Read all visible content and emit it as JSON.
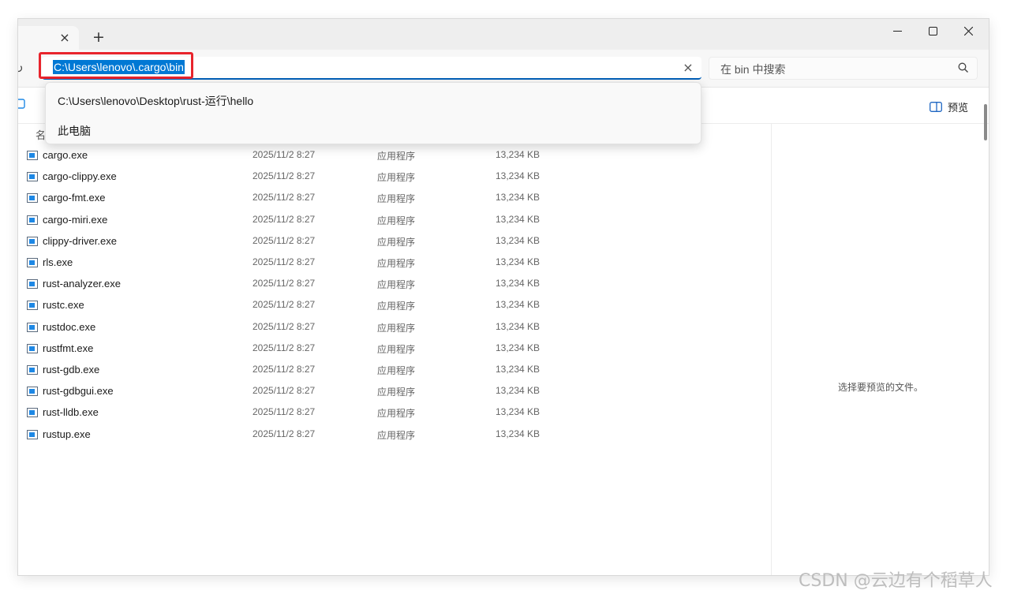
{
  "window": {
    "tab_close": "×",
    "new_tab": "+"
  },
  "toolbar": {
    "refresh_glyph": "↻",
    "address_value": "C:\\Users\\lenovo\\.cargo\\bin",
    "clear_glyph": "×",
    "search_placeholder": "在 bin 中搜索"
  },
  "commandbar": {
    "preview_label": "预览"
  },
  "address_suggestions": [
    "C:\\Users\\lenovo\\Desktop\\rust-运行\\hello",
    "此电脑"
  ],
  "file_list": {
    "name_header_fragment": "名",
    "rows": [
      {
        "name": "cargo.exe",
        "date": "2025/11/2 8:27",
        "type": "应用程序",
        "size": "13,234 KB"
      },
      {
        "name": "cargo-clippy.exe",
        "date": "2025/11/2 8:27",
        "type": "应用程序",
        "size": "13,234 KB"
      },
      {
        "name": "cargo-fmt.exe",
        "date": "2025/11/2 8:27",
        "type": "应用程序",
        "size": "13,234 KB"
      },
      {
        "name": "cargo-miri.exe",
        "date": "2025/11/2 8:27",
        "type": "应用程序",
        "size": "13,234 KB"
      },
      {
        "name": "clippy-driver.exe",
        "date": "2025/11/2 8:27",
        "type": "应用程序",
        "size": "13,234 KB"
      },
      {
        "name": "rls.exe",
        "date": "2025/11/2 8:27",
        "type": "应用程序",
        "size": "13,234 KB"
      },
      {
        "name": "rust-analyzer.exe",
        "date": "2025/11/2 8:27",
        "type": "应用程序",
        "size": "13,234 KB"
      },
      {
        "name": "rustc.exe",
        "date": "2025/11/2 8:27",
        "type": "应用程序",
        "size": "13,234 KB"
      },
      {
        "name": "rustdoc.exe",
        "date": "2025/11/2 8:27",
        "type": "应用程序",
        "size": "13,234 KB"
      },
      {
        "name": "rustfmt.exe",
        "date": "2025/11/2 8:27",
        "type": "应用程序",
        "size": "13,234 KB"
      },
      {
        "name": "rust-gdb.exe",
        "date": "2025/11/2 8:27",
        "type": "应用程序",
        "size": "13,234 KB"
      },
      {
        "name": "rust-gdbgui.exe",
        "date": "2025/11/2 8:27",
        "type": "应用程序",
        "size": "13,234 KB"
      },
      {
        "name": "rust-lldb.exe",
        "date": "2025/11/2 8:27",
        "type": "应用程序",
        "size": "13,234 KB"
      },
      {
        "name": "rustup.exe",
        "date": "2025/11/2 8:27",
        "type": "应用程序",
        "size": "13,234 KB"
      }
    ]
  },
  "preview_pane": {
    "message": "选择要预览的文件。"
  },
  "watermark": "CSDN @云边有个稻草人",
  "colors": {
    "accent": "#0078d4",
    "highlight_border": "#e8242c",
    "file_icon": "#1e88e5"
  },
  "icons": [
    "close-icon",
    "plus-icon",
    "minimize-icon",
    "maximize-icon",
    "refresh-icon",
    "search-icon",
    "preview-pane-icon",
    "exe-file-icon"
  ]
}
